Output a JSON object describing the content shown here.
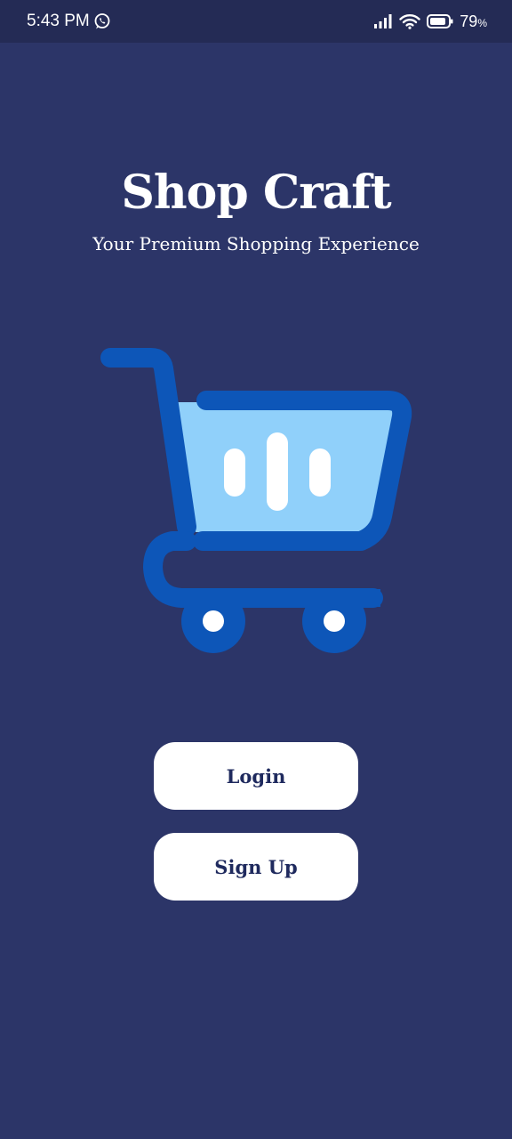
{
  "status_bar": {
    "time": "5:43 PM",
    "battery_percent": "79",
    "battery_unit": "%",
    "icons": [
      "whatsapp-icon",
      "signal-icon",
      "wifi-icon",
      "battery-icon"
    ]
  },
  "app": {
    "title": "Shop Craft",
    "tagline": "Your Premium Shopping Experience",
    "illustration": "shopping-cart-icon"
  },
  "buttons": {
    "login_label": "Login",
    "signup_label": "Sign Up"
  },
  "colors": {
    "background": "#2c3568",
    "status_bar": "#242b55",
    "cart_blue": "#0d56b8",
    "cart_basket": "#90d0fa",
    "button_bg": "#ffffff",
    "button_text": "#1f2a5e"
  }
}
